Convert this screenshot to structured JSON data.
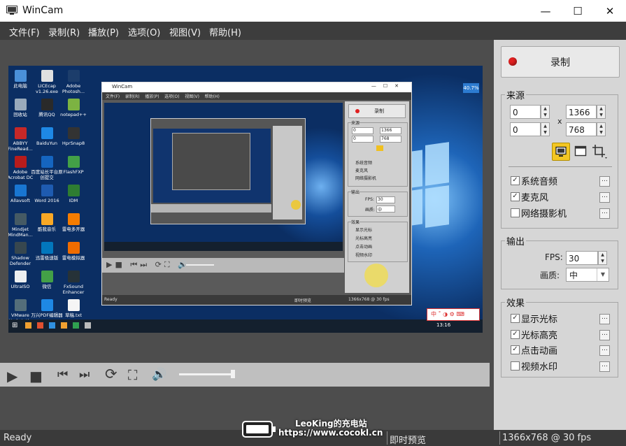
{
  "window": {
    "title": "WinCam",
    "controls": {
      "minimize": "—",
      "maximize": "☐",
      "close": "✕"
    }
  },
  "menu": [
    "文件(F)",
    "录制(R)",
    "播放(P)",
    "选项(O)",
    "视图(V)",
    "帮助(H)"
  ],
  "preview": {
    "badge": "40.7%",
    "desktop_icons": [
      {
        "label": "此电脑",
        "color": "#4a90d9"
      },
      {
        "label": "LICEcap v1.26.exe",
        "color": "#e0e0e0"
      },
      {
        "label": "Adobe Photosh...",
        "color": "#1c3d6b"
      },
      {
        "label": "回收站",
        "color": "#9ab"
      },
      {
        "label": "腾讯QQ",
        "color": "#2a2a2a"
      },
      {
        "label": "notepad++",
        "color": "#7cb342"
      },
      {
        "label": "ABBYY FineRead...",
        "color": "#c62828"
      },
      {
        "label": "BaiduYun",
        "color": "#1e88e5"
      },
      {
        "label": "HprSnap8",
        "color": "#333"
      },
      {
        "label": "Adobe Acrobat DC",
        "color": "#b71c1c"
      },
      {
        "label": "百度站长平台原创提交",
        "color": "#1565c0"
      },
      {
        "label": "FlashFXP",
        "color": "#43a047"
      },
      {
        "label": "Allavsoft",
        "color": "#1976d2"
      },
      {
        "label": "Word 2016",
        "color": "#1e5bb0"
      },
      {
        "label": "IDM",
        "color": "#2e7d32"
      },
      {
        "label": "Mindjet MindMan...",
        "color": "#455a64"
      },
      {
        "label": "酷我音乐",
        "color": "#f9a825"
      },
      {
        "label": "雷电多开器",
        "color": "#f57c00"
      },
      {
        "label": "Shadow Defender",
        "color": "#37474f"
      },
      {
        "label": "迅雷极速版",
        "color": "#0277bd"
      },
      {
        "label": "雷电模拟器",
        "color": "#ef6c00"
      },
      {
        "label": "UltraISO",
        "color": "#eceff1"
      },
      {
        "label": "微信",
        "color": "#43a047"
      },
      {
        "label": "FxSound Enhancer",
        "color": "#263238"
      },
      {
        "label": "VMware Workstati...",
        "color": "#546e7a"
      },
      {
        "label": "万兴PDF编辑器",
        "color": "#1e88e5"
      },
      {
        "label": "草稿.txt",
        "color": "#f5f5f5"
      }
    ],
    "inner": {
      "title": "WinCam",
      "menu": "文件(F)    录制(R)    播放(P)    选项(O)    视图(V)    帮助(H)",
      "record": "录制",
      "source": "来源",
      "x0": "0",
      "y0": "0",
      "w": "1366",
      "h": "768",
      "sys_audio": "系统音频",
      "mic": "麦克风",
      "webcam": "网络摄影机",
      "output": "输出",
      "fps_label": "FPS:",
      "fps": "30",
      "quality_label": "画质:",
      "quality": "中",
      "effects": "效果",
      "show_cursor": "显示光标",
      "cursor_hl": "光标高亮",
      "click_anim": "点击动画",
      "watermark": "视频水印",
      "status_ready": "Ready",
      "status_mode": "即时预览",
      "status_res": "1366x768 @ 30 fps"
    },
    "taskbar_time": "13:16",
    "tray_text": "中 ˚ ◑ ⚙ ⌨"
  },
  "player": {
    "play": "▶",
    "stop": "■",
    "prev": "⏮",
    "next": "⏭",
    "loop": "⟳",
    "fullscreen": "⛶",
    "volume": "🔊"
  },
  "panel": {
    "record_label": "录制",
    "source": {
      "title": "来源",
      "x": "0",
      "y": "0",
      "width": "1366",
      "height": "768",
      "times": "x"
    },
    "capture": {
      "sys_audio": {
        "label": "系统音频",
        "checked": true
      },
      "mic": {
        "label": "麦克风",
        "checked": true
      },
      "webcam": {
        "label": "网络摄影机",
        "checked": false
      }
    },
    "output": {
      "title": "输出",
      "fps_label": "FPS:",
      "fps": "30",
      "quality_label": "画质:",
      "quality": "中"
    },
    "effects": {
      "title": "效果",
      "show_cursor": {
        "label": "显示光标",
        "checked": true
      },
      "cursor_highlight": {
        "label": "光标高亮",
        "checked": true
      },
      "click_animation": {
        "label": "点击动画",
        "checked": true
      },
      "video_watermark": {
        "label": "视频水印",
        "checked": false
      }
    },
    "btn_glyph": "…",
    "check_glyph": "✓"
  },
  "status": {
    "ready": "Ready",
    "mode": "即时预览",
    "resolution": "1366x768 @ 30 fps"
  },
  "watermark": {
    "line1": "LeoKing的充电站",
    "line2": "https://www.cocokl.cn"
  },
  "colors": {
    "record_red": "#e02020",
    "accent_yellow": "#f0c020"
  }
}
